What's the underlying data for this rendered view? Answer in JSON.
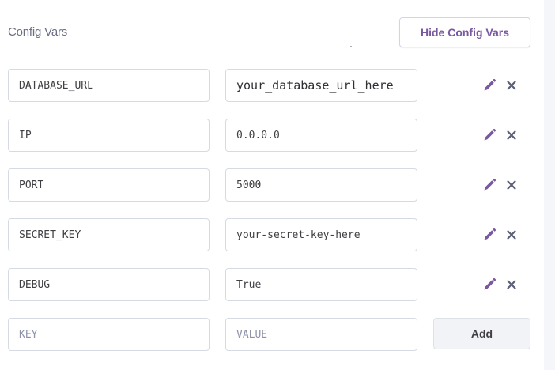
{
  "header": {
    "title": "Config Vars",
    "hide_button_label": "Hide Config Vars"
  },
  "colors": {
    "accent": "#79589f",
    "text_muted": "#6b6e84",
    "border": "#d6dae3"
  },
  "vars": [
    {
      "key": "DATABASE_URL",
      "value": "your_database_url_here"
    },
    {
      "key": "IP",
      "value": "0.0.0.0"
    },
    {
      "key": "PORT",
      "value": "5000"
    },
    {
      "key": "SECRET_KEY",
      "value": "your-secret-key-here"
    },
    {
      "key": "DEBUG",
      "value": "True"
    }
  ],
  "new_var": {
    "key_placeholder": "KEY",
    "value_placeholder": "VALUE",
    "add_label": "Add"
  },
  "icons": {
    "edit": "pencil-icon",
    "delete": "close-icon"
  }
}
